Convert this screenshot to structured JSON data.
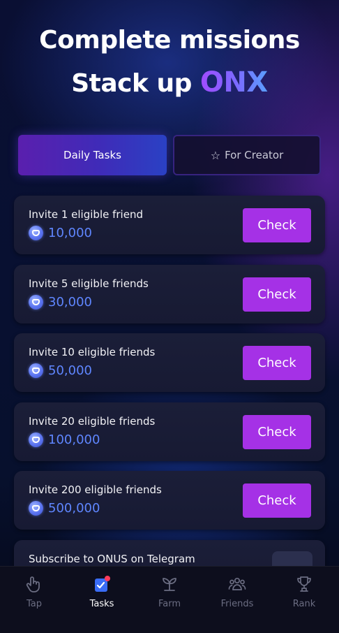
{
  "hero": {
    "line1": "Complete missions",
    "line2_prefix": "Stack up ",
    "line2_accent": "ONX"
  },
  "tabs": [
    {
      "label": "Daily Tasks",
      "icon": "none",
      "active": true
    },
    {
      "label": "For Creator",
      "icon": "star-icon",
      "active": false
    }
  ],
  "tasks": [
    {
      "title": "Invite 1 eligible friend",
      "reward": "10,000",
      "button": "Check"
    },
    {
      "title": "Invite 5 eligible friends",
      "reward": "30,000",
      "button": "Check"
    },
    {
      "title": "Invite 10 eligible friends",
      "reward": "50,000",
      "button": "Check"
    },
    {
      "title": "Invite 20 eligible friends",
      "reward": "100,000",
      "button": "Check"
    },
    {
      "title": "Invite 200 eligible friends",
      "reward": "500,000",
      "button": "Check"
    },
    {
      "title": "Subscribe to ONUS on Telegram"
    }
  ],
  "nav": [
    {
      "label": "Tap",
      "icon": "tap-hand-icon",
      "active": false
    },
    {
      "label": "Tasks",
      "icon": "tasks-icon",
      "active": true
    },
    {
      "label": "Farm",
      "icon": "farm-sprout-icon",
      "active": false
    },
    {
      "label": "Friends",
      "icon": "friends-icon",
      "active": false
    },
    {
      "label": "Rank",
      "icon": "trophy-icon",
      "active": false
    }
  ],
  "colors": {
    "accent_purple": "#a531e6",
    "reward_blue": "#5f86ff",
    "nav_inactive": "#6b6d82",
    "notification_red": "#ff3b5c"
  }
}
